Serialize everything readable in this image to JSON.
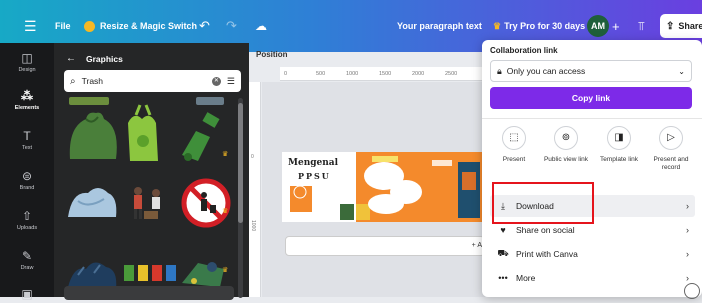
{
  "topbar": {
    "menu_icon": "hamburger-icon",
    "file_label": "File",
    "resize_label": "Resize & Magic Switch",
    "doc_title": "Your paragraph text",
    "try_pro_label": "Try Pro for 30 days",
    "avatar_initials": "AM",
    "share_label": "Share",
    "colors": {
      "gradient_start": "#17a9c6",
      "gradient_end": "#6a3fe0"
    }
  },
  "sidebar": {
    "items": [
      {
        "label": "Design",
        "icon": "layout-icon"
      },
      {
        "label": "Elements",
        "icon": "shapes-icon",
        "active": true
      },
      {
        "label": "Text",
        "icon": "text-icon"
      },
      {
        "label": "Brand",
        "icon": "brand-icon"
      },
      {
        "label": "Uploads",
        "icon": "upload-icon"
      },
      {
        "label": "Draw",
        "icon": "pen-icon"
      }
    ]
  },
  "panel": {
    "title": "Graphics",
    "search_value": "Trash"
  },
  "canvas": {
    "position_label": "Position",
    "ruler_ticks": [
      "0",
      "500",
      "1000",
      "1500",
      "2000",
      "2500"
    ],
    "vruler_ticks": [
      "0",
      "1000"
    ],
    "design_title_1": "Mengenal",
    "design_title_2": "PPSU",
    "add_page_label": "+ A"
  },
  "share_menu": {
    "header": "Collaboration link",
    "access_value": "Only you can access",
    "copy_link_label": "Copy link",
    "options": [
      {
        "label": "Present",
        "icon": "present-icon"
      },
      {
        "label": "Public view link",
        "icon": "link-icon"
      },
      {
        "label": "Template link",
        "icon": "template-icon"
      },
      {
        "label": "Present and record",
        "icon": "record-icon"
      }
    ],
    "rows": [
      {
        "label": "Download",
        "icon": "download-icon"
      },
      {
        "label": "Share on social",
        "icon": "heart-icon"
      },
      {
        "label": "Print with Canva",
        "icon": "truck-icon"
      },
      {
        "label": "More",
        "icon": "dots-icon"
      }
    ],
    "accent_color": "#7d2ae8",
    "highlight_color": "#e5141c"
  }
}
